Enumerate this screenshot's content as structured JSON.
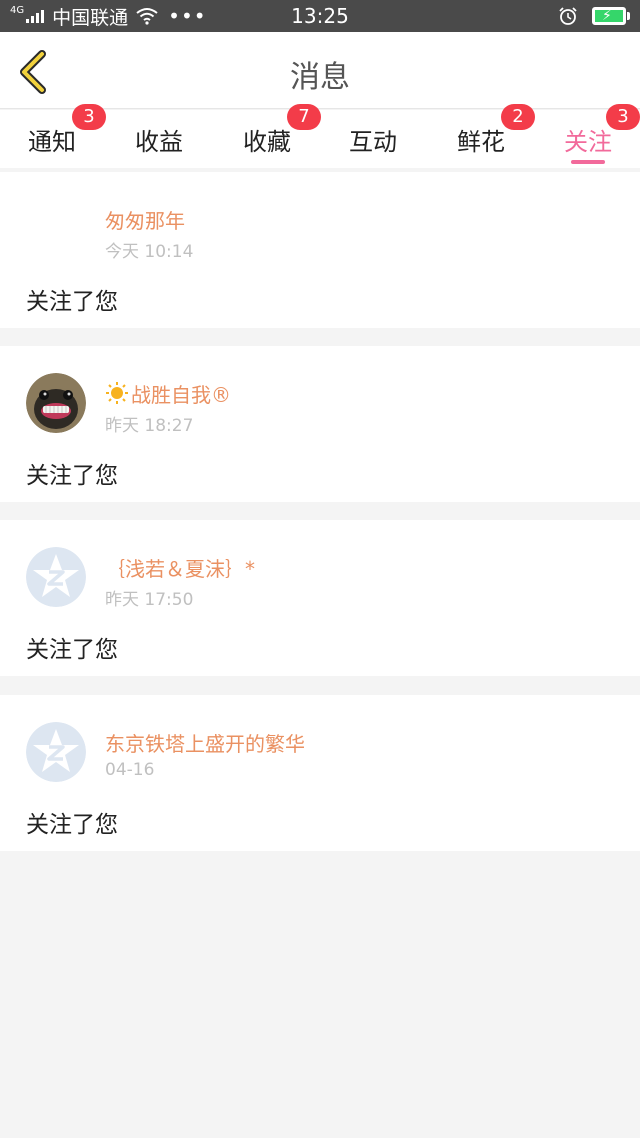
{
  "status_bar": {
    "network": "4G",
    "carrier": "中国联通",
    "more": "•••",
    "time": "13:25"
  },
  "header": {
    "title": "消息"
  },
  "tabs": [
    {
      "label": "通知",
      "badge": "3",
      "active": false
    },
    {
      "label": "收益",
      "badge": null,
      "active": false
    },
    {
      "label": "收藏",
      "badge": "7",
      "active": false
    },
    {
      "label": "互动",
      "badge": null,
      "active": false
    },
    {
      "label": "鲜花",
      "badge": "2",
      "active": false
    },
    {
      "label": "关注",
      "badge": "3",
      "active": true
    }
  ],
  "feed": {
    "items": [
      {
        "name": "匆匆那年",
        "time": "今天 10:14",
        "message": "关注了您",
        "avatar": "none"
      },
      {
        "name": "战胜自我®",
        "time": "昨天 18:27",
        "message": "关注了您",
        "avatar": "pug-photo"
      },
      {
        "name": "｛浅若＆夏沫｝*",
        "time": "昨天 17:50",
        "message": "关注了您",
        "avatar": "default-z"
      },
      {
        "name": "东京铁塔上盛开的繁华",
        "time": "04-16",
        "message": "关注了您",
        "avatar": "default-z"
      }
    ]
  },
  "colors": {
    "accent": "#f26a9b",
    "badge": "#f33c49",
    "username": "#ea9162",
    "back_arrow": "#f2d23c"
  }
}
